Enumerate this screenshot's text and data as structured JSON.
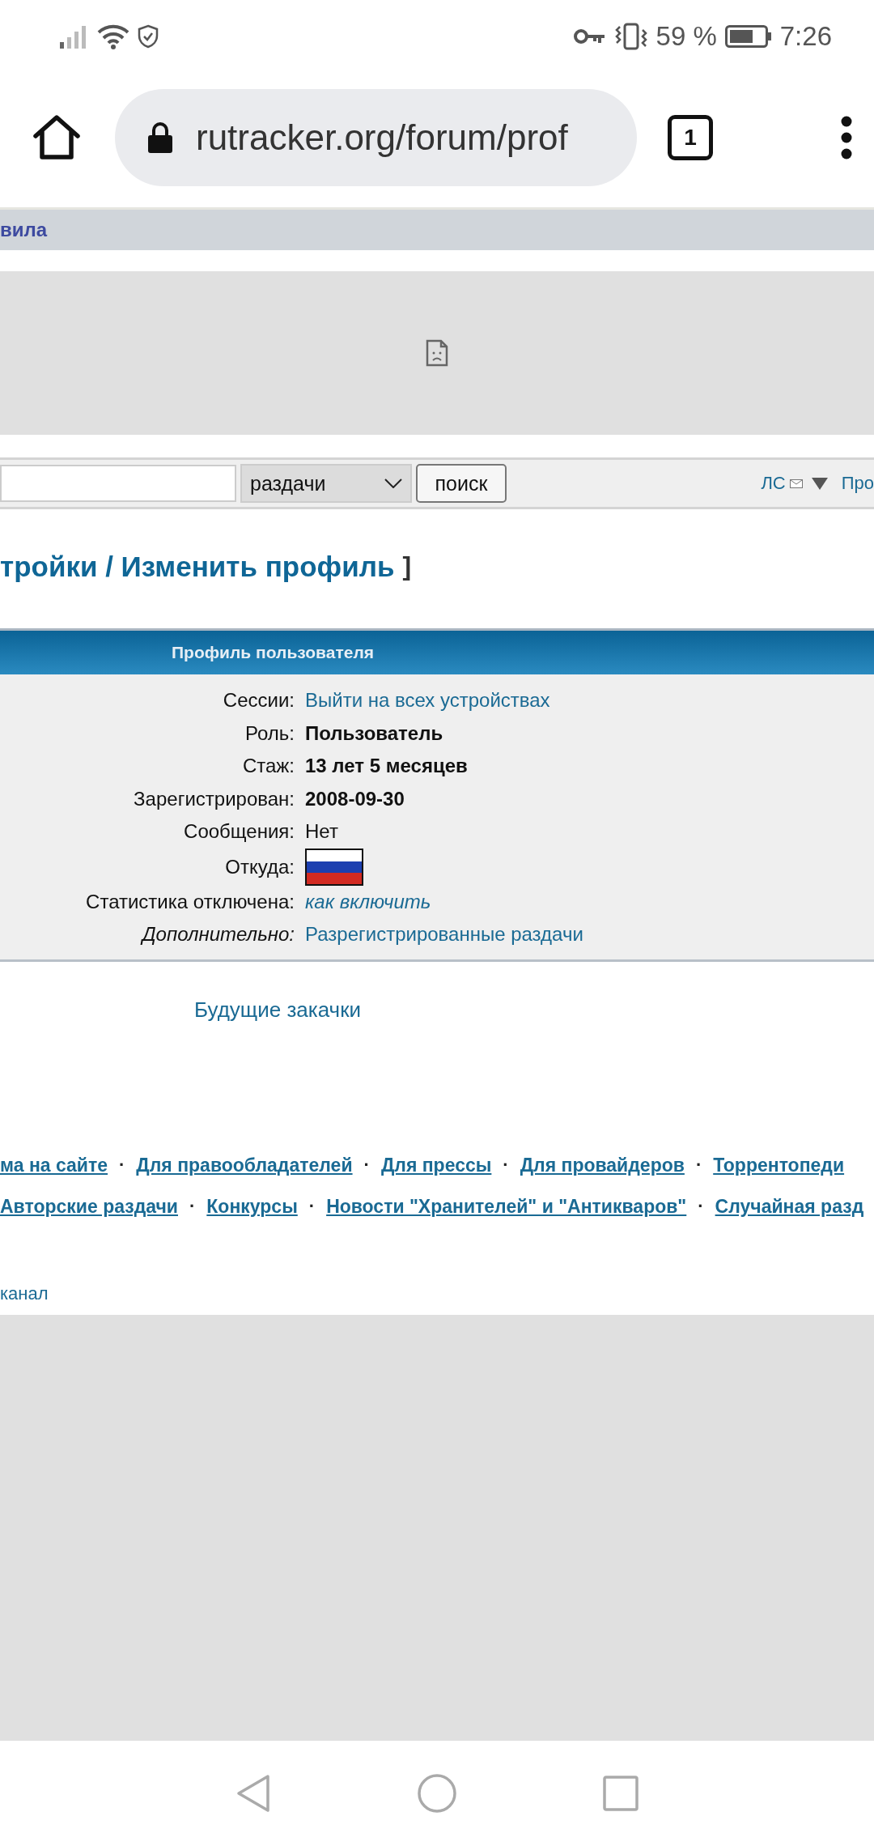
{
  "status_bar": {
    "battery": "59 %",
    "time": "7:26"
  },
  "browser": {
    "url": "rutracker.org/forum/prof",
    "tab_count": "1"
  },
  "nav_bar": {
    "text": "вила"
  },
  "search": {
    "category": "раздачи",
    "button": "поиск",
    "pm_link": "ЛС",
    "profile_link": "Про"
  },
  "page_title": {
    "text": "тройки / Изменить профиль",
    "bracket": "]"
  },
  "profile": {
    "title": "Профиль пользователя",
    "rows": [
      {
        "label": "Сессии:",
        "label_italic": false,
        "kind": "link",
        "value": "Выйти на всех устройствах"
      },
      {
        "label": "Роль:",
        "label_italic": false,
        "kind": "bold",
        "value": "Пользователь"
      },
      {
        "label": "Стаж:",
        "label_italic": false,
        "kind": "bold",
        "value": "13 лет 5 месяцев"
      },
      {
        "label": "Зарегистрирован:",
        "label_italic": false,
        "kind": "bold",
        "value": "2008-09-30"
      },
      {
        "label": "Сообщения:",
        "label_italic": false,
        "kind": "text",
        "value": "Нет"
      },
      {
        "label": "Откуда:",
        "label_italic": false,
        "kind": "flag"
      },
      {
        "label": "Статистика отключена:",
        "label_italic": false,
        "kind": "italic-link",
        "value": "как включить"
      },
      {
        "label": "Дополнительно:",
        "label_italic": true,
        "kind": "link",
        "value": "Разрегистрированные раздачи"
      }
    ]
  },
  "future_downloads": "Будущие закачки",
  "footer": {
    "separator": "·",
    "rows": [
      {
        "links": [
          "ма на сайте",
          "Для правообладателей",
          "Для прессы",
          "Для провайдеров",
          "Торрентопеди"
        ]
      },
      {
        "links": [
          "Авторские раздачи",
          "Конкурсы",
          "Новости \"Хранителей\" и \"Антикваров\"",
          "Случайная разд"
        ]
      }
    ]
  },
  "channel_link": "канал"
}
